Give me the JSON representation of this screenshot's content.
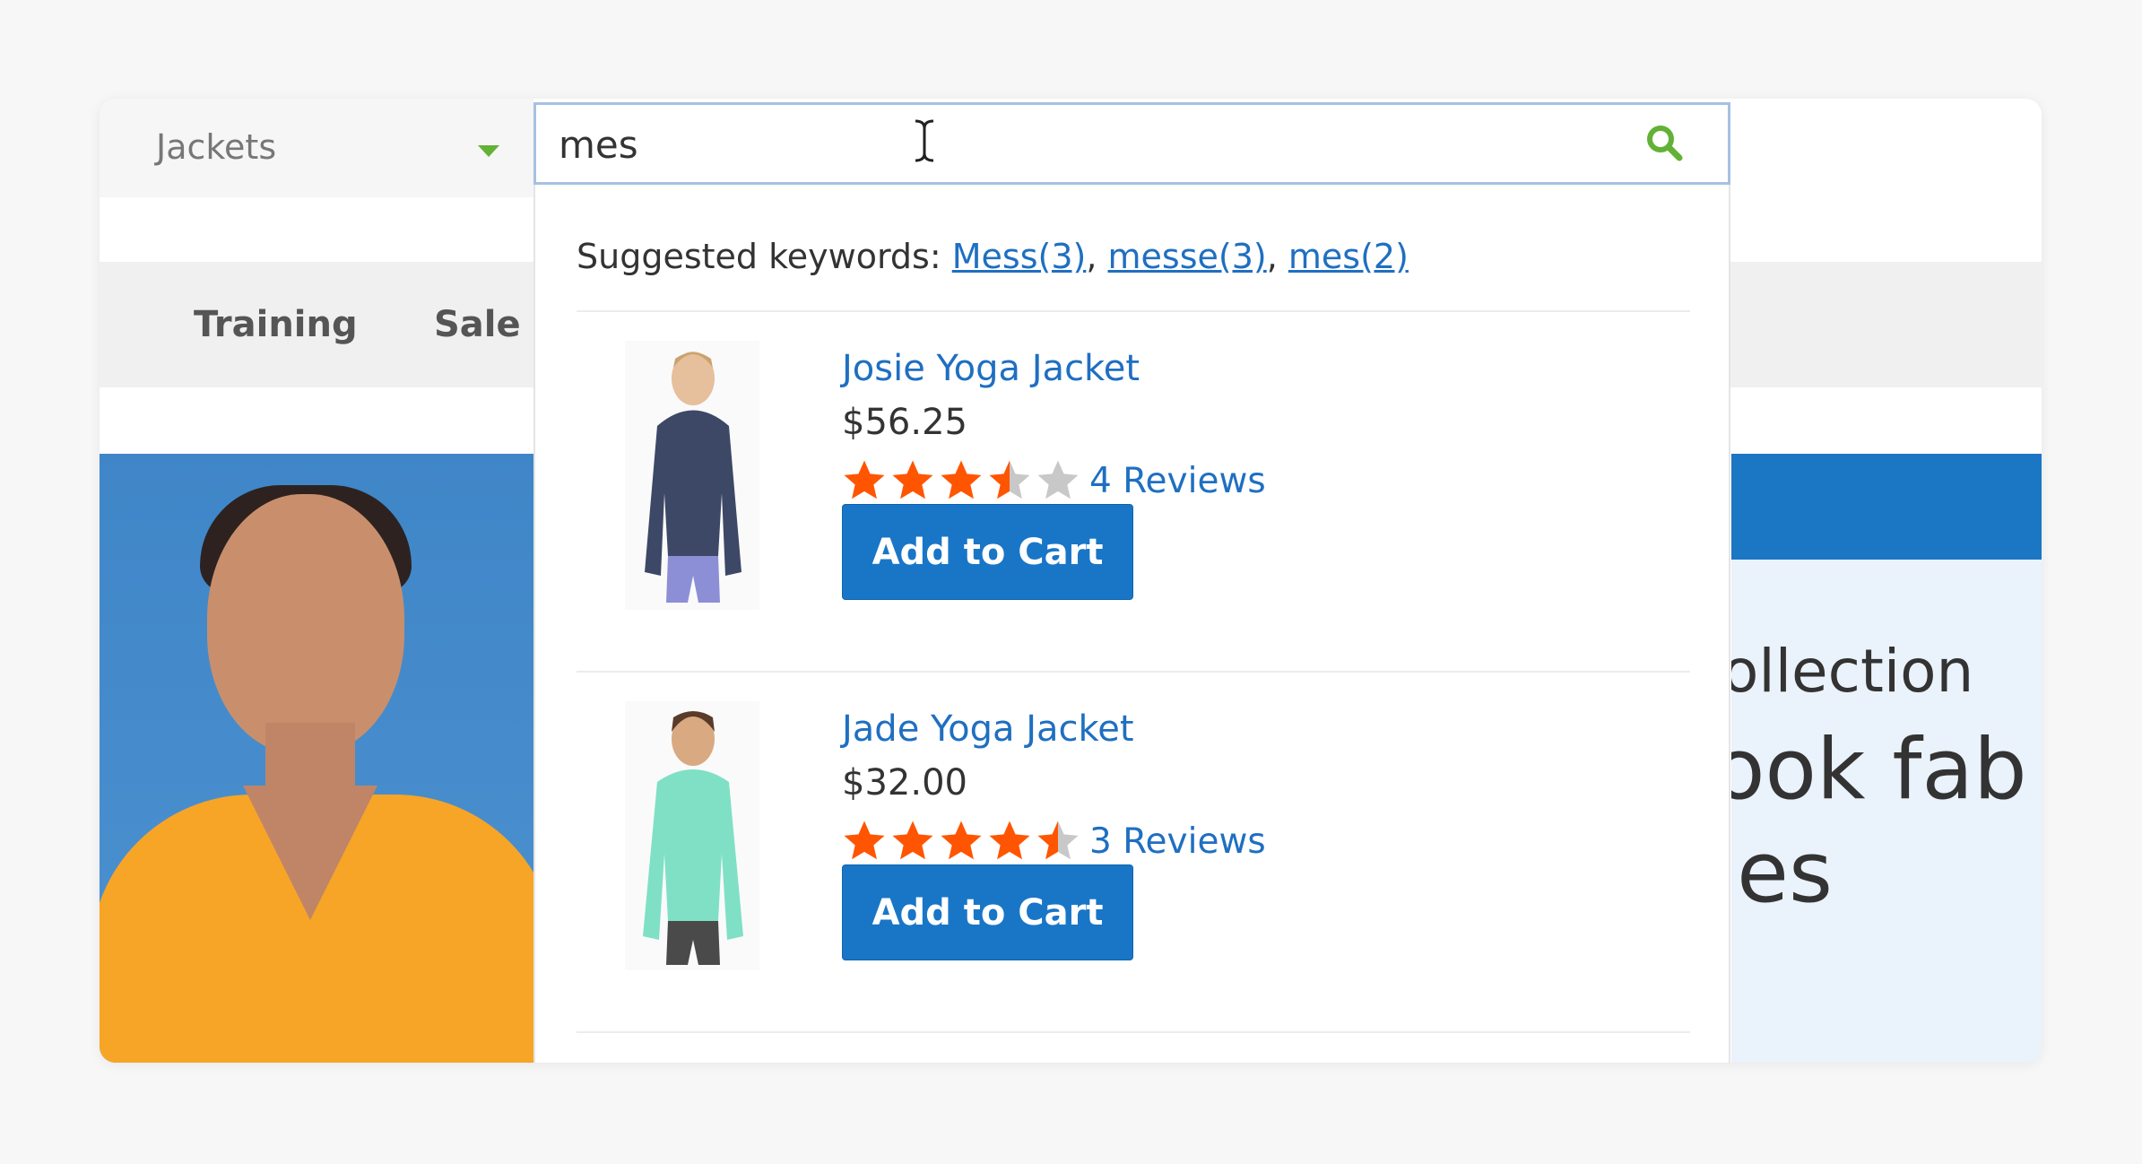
{
  "category_select": {
    "selected": "Jackets"
  },
  "nav": {
    "items": [
      "Training",
      "Sale"
    ]
  },
  "search": {
    "value": "mes"
  },
  "suggestions": {
    "label": "Suggested keywords:",
    "keywords": [
      "Mess(3)",
      "messe(3)",
      "mes(2)"
    ]
  },
  "products": [
    {
      "name": "Josie Yoga Jacket",
      "price": "$56.25",
      "rating": 3.5,
      "rating_max": 5,
      "reviews": "4 Reviews",
      "button": "Add to Cart",
      "jacket_color": "#3d4866",
      "pants_color": "#8c8fd6"
    },
    {
      "name": "Jade Yoga Jacket",
      "price": "$32.00",
      "rating": 4.5,
      "rating_max": 5,
      "reviews": "3 Reviews",
      "button": "Add to Cart",
      "jacket_color": "#7fe0c5",
      "pants_color": "#4a4a4a"
    }
  ],
  "hero_right": {
    "line1": "ollection",
    "line2": "ook fab i",
    "line3": "les"
  },
  "colors": {
    "accent": "#1976c7",
    "link": "#1f6fc1",
    "star_filled": "#ff5501",
    "star_empty": "#c8c8c8",
    "search_icon": "#62b235"
  }
}
